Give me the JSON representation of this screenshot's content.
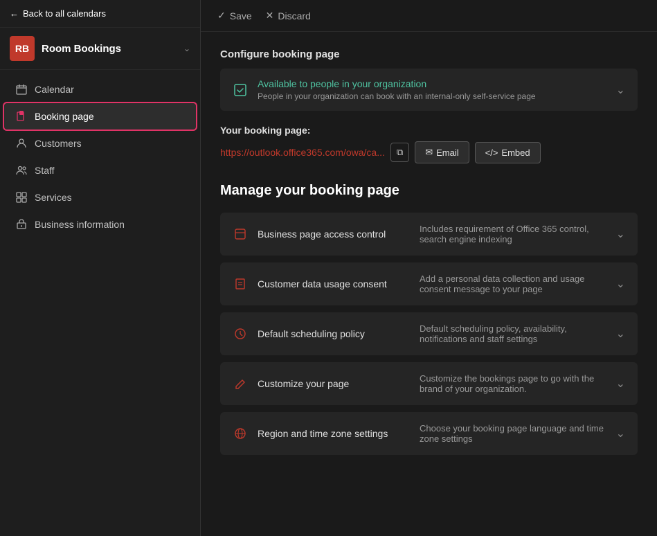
{
  "app": {
    "avatar_initials": "RB",
    "name": "Room Bookings",
    "back_label": "Back to all calendars"
  },
  "nav": {
    "items": [
      {
        "id": "calendar",
        "label": "Calendar",
        "active": false
      },
      {
        "id": "booking-page",
        "label": "Booking page",
        "active": true
      },
      {
        "id": "customers",
        "label": "Customers",
        "active": false
      },
      {
        "id": "staff",
        "label": "Staff",
        "active": false
      },
      {
        "id": "services",
        "label": "Services",
        "active": false
      },
      {
        "id": "business-information",
        "label": "Business information",
        "active": false
      }
    ]
  },
  "topbar": {
    "save_label": "Save",
    "discard_label": "Discard"
  },
  "configure": {
    "section_title": "Configure booking page",
    "availability_primary": "Available to people in your organization",
    "availability_secondary": "People in your organization can book with an internal-only self-service page"
  },
  "booking_url": {
    "label": "Your booking page:",
    "url": "https://outlook.office365.com/owa/ca...",
    "email_label": "Email",
    "embed_label": "Embed"
  },
  "manage": {
    "title": "Manage your booking page",
    "items": [
      {
        "id": "access-control",
        "name": "Business page access control",
        "desc": "Includes requirement of Office 365 control, search engine indexing"
      },
      {
        "id": "data-consent",
        "name": "Customer data usage consent",
        "desc": "Add a personal data collection and usage consent message to your page"
      },
      {
        "id": "scheduling-policy",
        "name": "Default scheduling policy",
        "desc": "Default scheduling policy, availability, notifications and staff settings"
      },
      {
        "id": "customize-page",
        "name": "Customize your page",
        "desc": "Customize the bookings page to go with the brand of your organization."
      },
      {
        "id": "region-timezone",
        "name": "Region and time zone settings",
        "desc": "Choose your booking page language and time zone settings"
      }
    ]
  }
}
